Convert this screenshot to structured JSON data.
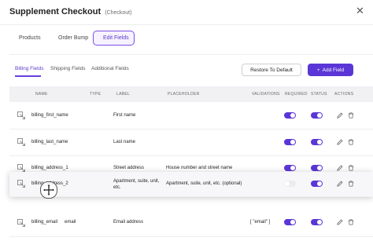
{
  "header": {
    "title": "Supplement Checkout",
    "subtitle": "(Checkout)",
    "close_glyph": "✕"
  },
  "topnav": [
    {
      "label": "Products",
      "icon": "grid-icon"
    },
    {
      "label": "Order Bump",
      "icon": "cart-icon"
    },
    {
      "label": "Edit Fields",
      "icon": "pencil-icon",
      "active": true
    }
  ],
  "subtabs": [
    "Billing Fields",
    "Shipping Fields",
    "Additional Fields"
  ],
  "actions": {
    "restore": "Restore To Default",
    "add_plus": "+",
    "add": "Add Field"
  },
  "columns": [
    "NAME",
    "TYPE",
    "LABEL",
    "PLACEHOLDER",
    "VALIDATIONS",
    "REQUIRED",
    "STATUS",
    "ACTIONS"
  ],
  "rows": [
    {
      "name": "billing_first_name",
      "type": "",
      "label": "First name",
      "placeholder": "",
      "validations": "",
      "required": true,
      "status": true
    },
    {
      "name": "billing_last_name",
      "type": "",
      "label": "Last name",
      "placeholder": "",
      "validations": "",
      "required": true,
      "status": true
    },
    {
      "name": "billing_address_1",
      "type": "",
      "label": "Street address",
      "placeholder": "House number and street name",
      "validations": "",
      "required": true,
      "status": true
    },
    {
      "name": "billing_address_2",
      "type": "",
      "label": "Apartment, suite, unit, etc.",
      "placeholder": "Apartment, suite, unit, etc. (optional)",
      "validations": "",
      "required": false,
      "status": true
    },
    {
      "name": "billing_email",
      "type": "email",
      "label": "Email address",
      "placeholder": "",
      "validations": "[ \"email\" ]",
      "required": true,
      "status": true
    }
  ],
  "colors": {
    "accent": "#5b36d6"
  }
}
